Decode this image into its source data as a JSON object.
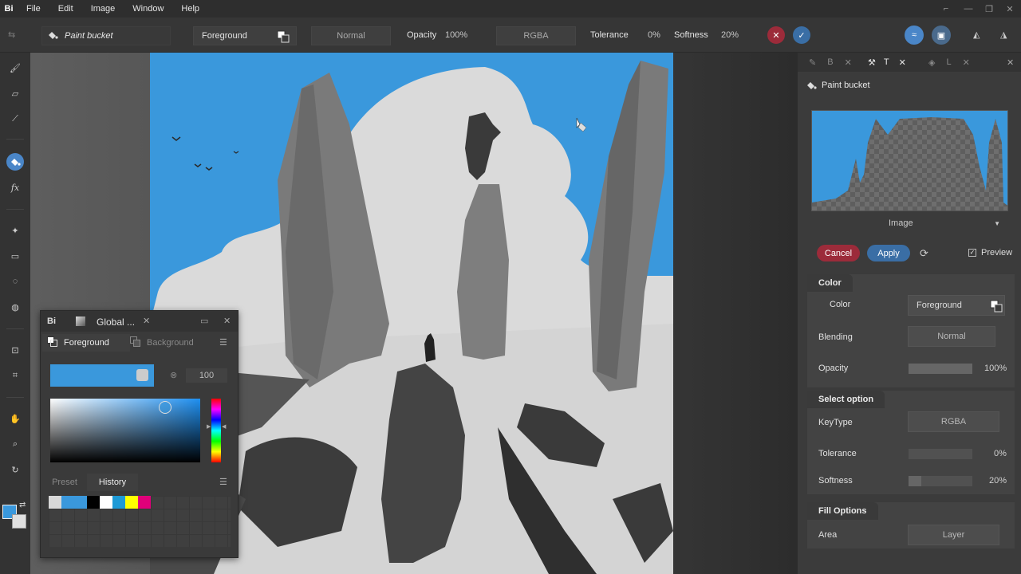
{
  "menu": {
    "logo": "Bi",
    "items": [
      "File",
      "Edit",
      "Image",
      "Window",
      "Help"
    ]
  },
  "toolbar": {
    "tool_name": "Paint bucket",
    "color_source": "Foreground",
    "blend": "Normal",
    "opacity_label": "Opacity",
    "opacity_value": "100%",
    "keytype": "RGBA",
    "tolerance_label": "Tolerance",
    "tolerance_value": "0%",
    "softness_label": "Softness",
    "softness_value": "20%"
  },
  "panel": {
    "tabs": [
      "B",
      "T",
      "L"
    ],
    "title": "Paint bucket",
    "preview_dropdown": "Image",
    "cancel": "Cancel",
    "apply": "Apply",
    "preview": "Preview",
    "color_section": {
      "header": "Color",
      "color_label": "Color",
      "color_value": "Foreground",
      "blending_label": "Blending",
      "blending_value": "Normal",
      "opacity_label": "Opacity",
      "opacity_value": "100%",
      "opacity": 1.0
    },
    "select_section": {
      "header": "Select option",
      "keytype_label": "KeyType",
      "keytype_value": "RGBA",
      "tolerance_label": "Tolerance",
      "tolerance_value": "0%",
      "tolerance": 0.0,
      "softness_label": "Softness",
      "softness_value": "20%",
      "softness": 0.2
    },
    "fill_section": {
      "header": "Fill Options",
      "area_label": "Area",
      "area_value": "Layer"
    }
  },
  "color_window": {
    "logo": "Bi",
    "title": "Global ...",
    "tab_fg": "Foreground",
    "tab_bg": "Background",
    "alpha_value": "100",
    "current_color": "#3a98dc",
    "tab_preset": "Preset",
    "tab_history": "History",
    "history": [
      "#d8d8d8",
      "#3a98dc",
      "#3a98dc",
      "#000000",
      "#ffffff",
      "#1e9ad6",
      "#ffff00",
      "#e0007a"
    ]
  },
  "colors": {
    "accent": "#4a86c8",
    "canvas_sky": "#3a98dc",
    "cancel": "#9c2b3a",
    "apply": "#3a6ea5"
  }
}
